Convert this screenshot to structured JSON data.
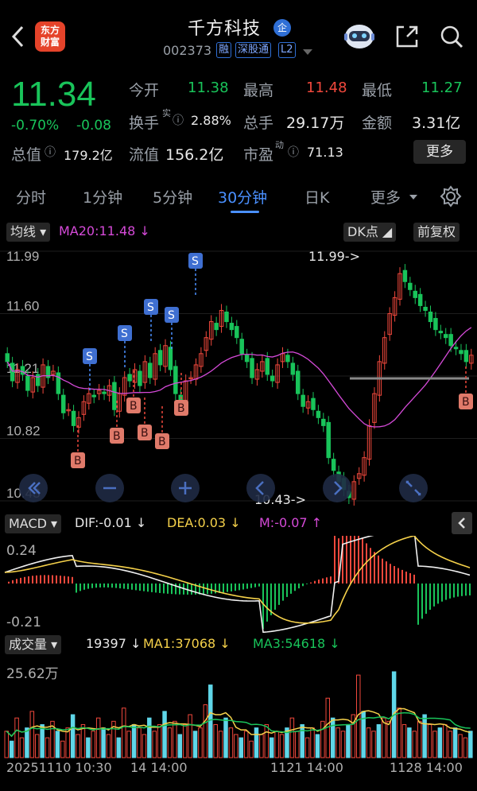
{
  "header": {
    "logo_line1": "东方",
    "logo_line2": "财富",
    "title": "千方科技",
    "title_badge": "企",
    "code": "002373",
    "tags": [
      "融",
      "深股通",
      "L2"
    ]
  },
  "quote": {
    "price": "11.34",
    "change_pct": "-0.70%",
    "change": "-0.08",
    "open_label": "今开",
    "open": "11.38",
    "high_label": "最高",
    "high": "11.48",
    "low_label": "最低",
    "low": "11.27",
    "turnover_label": "换手",
    "turnover_sup": "实",
    "turnover": "2.88%",
    "volume_label": "总手",
    "volume": "29.17万",
    "amount_label": "金额",
    "amount": "3.31亿",
    "mcap_label": "总值",
    "mcap": "179.2亿",
    "float_label": "流值",
    "float": "156.2亿",
    "pe_label": "市盈",
    "pe_sup": "动",
    "pe": "71.13",
    "more": "更多"
  },
  "tabs": [
    "分时",
    "1分钟",
    "5分钟",
    "30分钟",
    "日K",
    "更多"
  ],
  "active_tab": "30分钟",
  "chart_toolbar": {
    "indicator": "均线",
    "ma20": "MA20:11.48",
    "dk": "DK点",
    "adjust": "前复权"
  },
  "colors": {
    "up": "#f0483c",
    "down": "#19c45a",
    "accent": "#4a90ff",
    "ma20": "#d54ad8",
    "dea": "#f5d14a"
  },
  "chart_data": [
    {
      "type": "candlestick",
      "title": "",
      "y_ticks": [
        "11.99",
        "11.60",
        "11.21",
        "10.82",
        "10.43"
      ],
      "ylim": [
        10.43,
        11.99
      ],
      "annotations": [
        "11.99->",
        "10.43->"
      ],
      "series": [
        {
          "name": "MA20:11.48",
          "type": "line"
        }
      ],
      "closes": [
        11.3,
        11.18,
        11.25,
        11.22,
        11.12,
        11.2,
        11.15,
        11.28,
        11.2,
        11.24,
        11.1,
        10.98,
        11.0,
        10.9,
        10.95,
        11.05,
        11.1,
        11.08,
        11.12,
        11.1,
        11.15,
        11.0,
        11.1,
        11.2,
        11.18,
        11.25,
        11.15,
        11.3,
        11.2,
        11.35,
        11.28,
        11.4,
        11.25,
        11.1,
        11.05,
        11.18,
        11.2,
        11.28,
        11.35,
        11.45,
        11.55,
        11.5,
        11.62,
        11.55,
        11.5,
        11.45,
        11.35,
        11.3,
        11.2,
        11.25,
        11.3,
        11.22,
        11.18,
        11.28,
        11.35,
        11.3,
        11.22,
        11.1,
        11.02,
        11.05,
        11.0,
        10.95,
        10.9,
        10.7,
        10.62,
        10.55,
        10.5,
        10.45,
        10.55,
        10.6,
        10.7,
        10.9,
        11.1,
        11.3,
        11.45,
        11.6,
        11.7,
        11.85,
        11.8,
        11.75,
        11.7,
        11.65,
        11.62,
        11.55,
        11.5,
        11.48,
        11.45,
        11.4,
        11.38,
        11.35,
        11.3,
        11.34
      ]
    },
    {
      "type": "bar",
      "title": "MACD",
      "y_ticks": [
        "0.24",
        "-0.21"
      ],
      "series": [
        {
          "name": "DIF:-0.01"
        },
        {
          "name": "DEA:0.03"
        },
        {
          "name": "M:-0.07"
        }
      ]
    },
    {
      "type": "bar",
      "title": "成交量",
      "y_ticks": [
        "25.62万"
      ],
      "x_ticks": [
        "20251110 10:30",
        "14 14:00",
        "1121 14:00",
        "1128 14:00"
      ],
      "series": [
        {
          "name": "19397"
        },
        {
          "name": "MA1:37068"
        },
        {
          "name": "MA3:54618"
        }
      ],
      "values": [
        8,
        5,
        12,
        6,
        9,
        14,
        7,
        10,
        6,
        11,
        8,
        5,
        9,
        13,
        7,
        10,
        6,
        8,
        12,
        9,
        7,
        11,
        6,
        15,
        8,
        10,
        9,
        7,
        12,
        8,
        10,
        14,
        9,
        11,
        7,
        10,
        13,
        8,
        9,
        16,
        22,
        10,
        8,
        12,
        9,
        7,
        6,
        8,
        5,
        9,
        7,
        10,
        6,
        8,
        7,
        9,
        12,
        8,
        10,
        6,
        9,
        7,
        11,
        18,
        12,
        9,
        8,
        10,
        13,
        25,
        14,
        9,
        8,
        10,
        12,
        11,
        26,
        15,
        10,
        9,
        8,
        11,
        13,
        10,
        8,
        9,
        10,
        8,
        9,
        7,
        6,
        8
      ]
    }
  ],
  "macd_panel": {
    "label": "MACD",
    "dif": "DIF:-0.01",
    "dea": "DEA:0.03",
    "m": "M:-0.07"
  },
  "vol_panel": {
    "label": "成交量",
    "vol": "19397",
    "ma1": "MA1:37068",
    "ma3": "MA3:54618"
  }
}
